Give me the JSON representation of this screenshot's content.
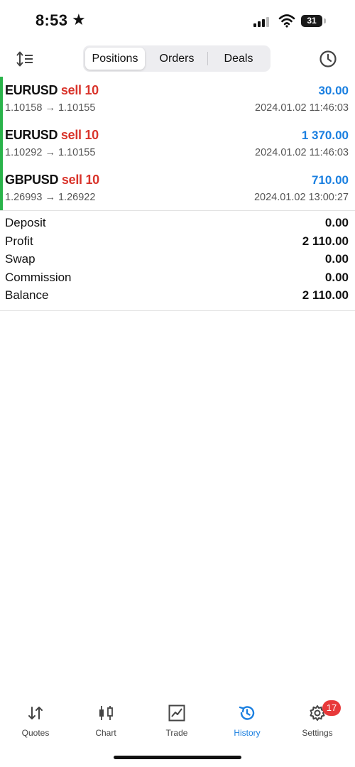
{
  "status_bar": {
    "time": "8:53",
    "star": "★",
    "battery": "31"
  },
  "toolbar": {
    "sort_icon": "sort-icon",
    "tabs": [
      {
        "label": "Positions",
        "active": true
      },
      {
        "label": "Orders",
        "active": false
      },
      {
        "label": "Deals",
        "active": false
      }
    ],
    "clock_icon": "clock-icon"
  },
  "positions": [
    {
      "symbol": "EURUSD",
      "side": "sell 10",
      "profit": "30.00",
      "prices": "1.10158 → 1.10155",
      "time": "2024.01.02 11:46:03"
    },
    {
      "symbol": "EURUSD",
      "side": "sell 10",
      "profit": "1 370.00",
      "prices": "1.10292 → 1.10155",
      "time": "2024.01.02 11:46:03"
    },
    {
      "symbol": "GBPUSD",
      "side": "sell 10",
      "profit": "710.00",
      "prices": "1.26993 → 1.26922",
      "time": "2024.01.02 13:00:27"
    }
  ],
  "summary": [
    {
      "label": "Deposit",
      "value": "0.00"
    },
    {
      "label": "Profit",
      "value": "2 110.00"
    },
    {
      "label": "Swap",
      "value": "0.00"
    },
    {
      "label": "Commission",
      "value": "0.00"
    },
    {
      "label": "Balance",
      "value": "2 110.00"
    }
  ],
  "tab_bar": [
    {
      "label": "Quotes",
      "icon": "quotes-icon",
      "active": false
    },
    {
      "label": "Chart",
      "icon": "chart-icon",
      "active": false
    },
    {
      "label": "Trade",
      "icon": "trade-icon",
      "active": false
    },
    {
      "label": "History",
      "icon": "history-icon",
      "active": true
    },
    {
      "label": "Settings",
      "icon": "settings-icon",
      "active": false,
      "badge": "17"
    }
  ],
  "colors": {
    "accent": "#1a7fe0",
    "sell": "#d9342b",
    "position_bar": "#2ab34a",
    "badge": "#e8393a"
  }
}
